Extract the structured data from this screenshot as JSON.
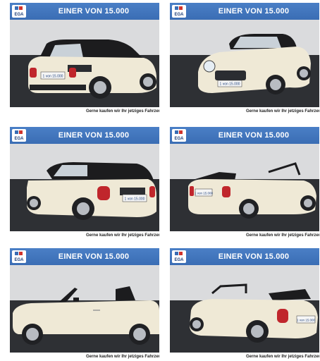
{
  "listing_photos": [
    {
      "logo_text": "EGA",
      "headline": "EINER VON 15.000",
      "tagline": "Gerne kaufen wir Ihr jetziges Fahrzeug",
      "plate": "1 von 15.000"
    },
    {
      "logo_text": "EGA",
      "headline": "EINER VON 15.000",
      "tagline": "Gerne kaufen wir Ihr jetziges Fahrzeug",
      "plate": "1 von 15.000"
    },
    {
      "logo_text": "EGA",
      "headline": "EINER VON 15.000",
      "tagline": "Gerne kaufen wir Ihr jetziges Fahrzeug",
      "plate": "1 von 15.000"
    },
    {
      "logo_text": "EGA",
      "headline": "EINER VON 15.000",
      "tagline": "Gerne kaufen wir Ihr jetziges Fahrzeug",
      "plate": "1 von 15.000"
    },
    {
      "logo_text": "EGA",
      "headline": "EINER VON 15.000",
      "tagline": "Gerne kaufen wir Ihr jetziges Fahrzeug",
      "plate": ""
    },
    {
      "logo_text": "EGA",
      "headline": "EINER VON 15.000",
      "tagline": "Gerne kaufen wir Ihr jetziges Fahrzeug",
      "plate": "1 von 15.000"
    }
  ],
  "colors": {
    "banner": "#3a6db4",
    "car_body": "#efe9d6",
    "roof": "#1c1c1e",
    "floor": "#2e3034",
    "wall": "#dcdcdc"
  }
}
